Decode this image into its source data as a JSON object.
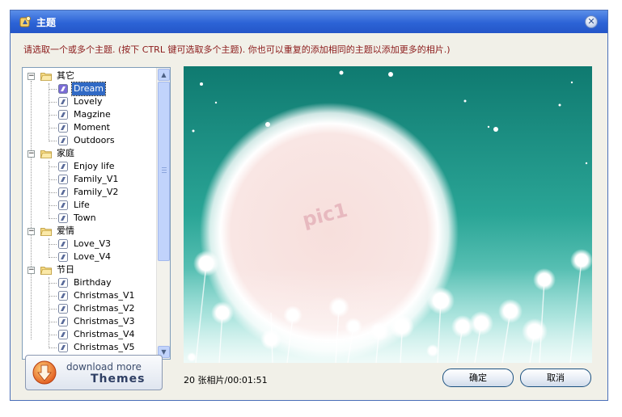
{
  "window": {
    "title": "主题",
    "close_glyph": "✕"
  },
  "instruction": "请选取一个或多个主题. (按下 CTRL 键可选取多个主题). 你也可以重复的添加相同的主题以添加更多的相片.)",
  "tree": {
    "groups": [
      {
        "label": "其它",
        "expander": "−",
        "items": [
          "Dream",
          "Lovely",
          "Magzine",
          "Moment",
          "Outdoors"
        ]
      },
      {
        "label": "家庭",
        "expander": "−",
        "items": [
          "Enjoy life",
          "Family_V1",
          "Family_V2",
          "Life",
          "Town"
        ]
      },
      {
        "label": "爱情",
        "expander": "−",
        "items": [
          "Love_V3",
          "Love_V4"
        ]
      },
      {
        "label": "节日",
        "expander": "−",
        "items": [
          "Birthday",
          "Christmas_V1",
          "Christmas_V2",
          "Christmas_V3",
          "Christmas_V4",
          "Christmas_V5"
        ]
      }
    ],
    "selected": "Dream"
  },
  "download": {
    "line1": "download more",
    "line2": "Themes"
  },
  "preview": {
    "placeholder": "pic1"
  },
  "status": "20 张相片/00:01:51",
  "buttons": {
    "ok": "确定",
    "cancel": "取消"
  },
  "colors": {
    "titlebar": "#2c63d6",
    "selection": "#316ac5",
    "instruction": "#8b1a1a",
    "preview_bg": "#2a9688"
  }
}
